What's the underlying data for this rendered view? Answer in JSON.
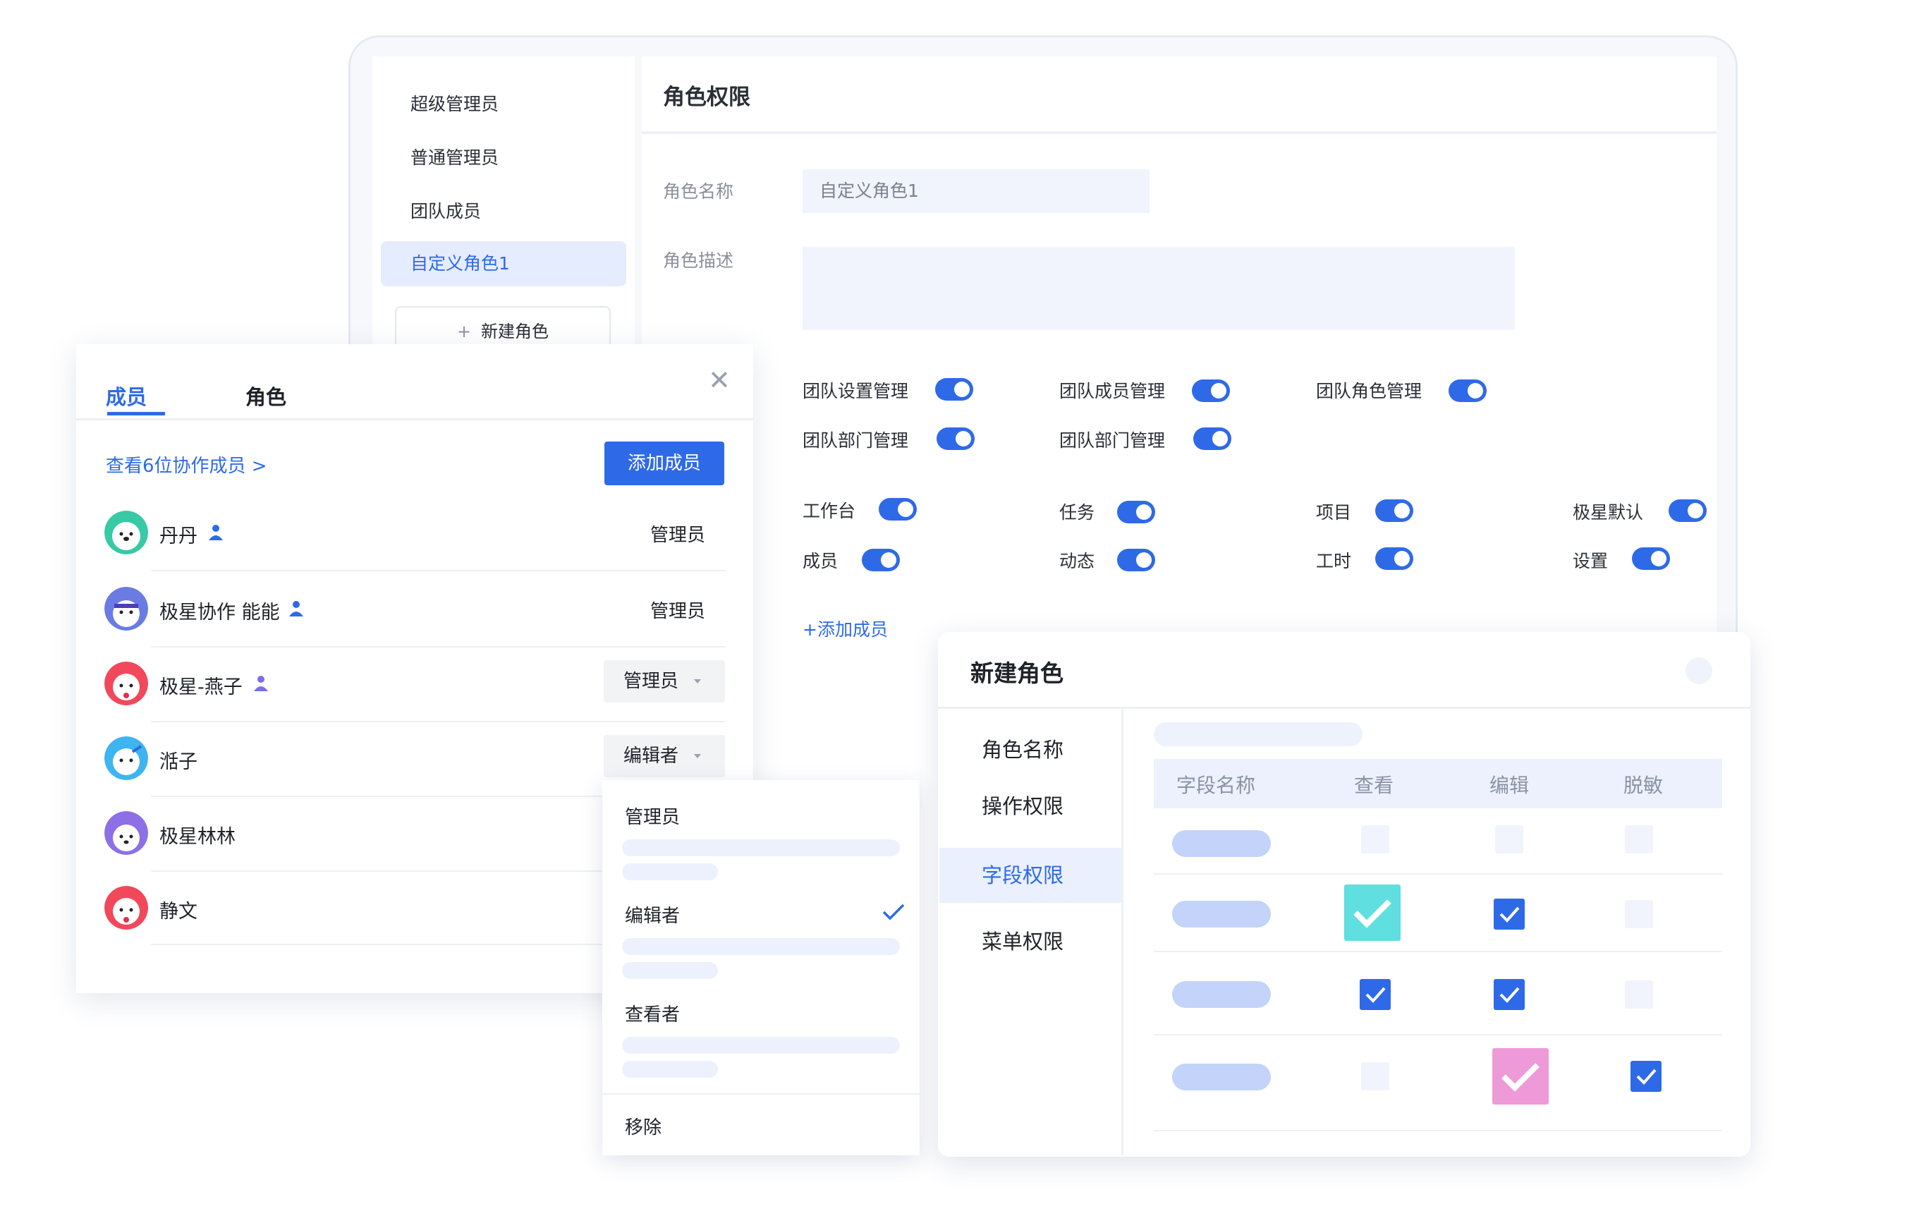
{
  "roles_window": {
    "roles": [
      "超级管理员",
      "普通管理员",
      "团队成员",
      "自定义角色1"
    ],
    "new_role_button": "新建角色",
    "title": "角色权限",
    "name_label": "角色名称",
    "name_value": "自定义角色1",
    "desc_label": "角色描述",
    "admin_perms": [
      "团队设置管理",
      "团队成员管理",
      "团队角色管理",
      "团队部门管理",
      "团队部门管理"
    ],
    "module_perms": [
      "工作台",
      "任务",
      "项目",
      "极星默认",
      "成员",
      "动态",
      "工时",
      "设置"
    ],
    "add_member": "+添加成员"
  },
  "member_panel": {
    "tab_members": "成员",
    "tab_roles": "角色",
    "view_collaborators": "查看6位协作成员 >",
    "add_button": "添加成员",
    "members": [
      {
        "name": "丹丹",
        "role": "管理员"
      },
      {
        "name": "极星协作 能能",
        "role": "管理员"
      },
      {
        "name": "极星-燕子",
        "role": "管理员"
      },
      {
        "name": "湉子",
        "role": "编辑者"
      },
      {
        "name": "极星林林",
        "role": ""
      },
      {
        "name": "静文",
        "role": ""
      }
    ]
  },
  "role_dropdown": {
    "options": [
      "管理员",
      "编辑者",
      "查看者",
      "移除"
    ],
    "selected": "编辑者"
  },
  "new_role_dialog": {
    "title": "新建角色",
    "nav": [
      "角色名称",
      "操作权限",
      "字段权限",
      "菜单权限"
    ],
    "active_nav": "字段权限",
    "columns": [
      "字段名称",
      "查看",
      "编辑",
      "脱敏"
    ],
    "rows": [
      {
        "view": false,
        "edit": false,
        "mask": false
      },
      {
        "view": true,
        "edit": true,
        "mask": false
      },
      {
        "view": true,
        "edit": true,
        "mask": false
      },
      {
        "view": false,
        "edit": true,
        "mask": true
      }
    ]
  },
  "colors": {
    "primary": "#2e6ae8",
    "teal_check": "#5fdfe0",
    "pink_check": "#ee9ad8"
  }
}
